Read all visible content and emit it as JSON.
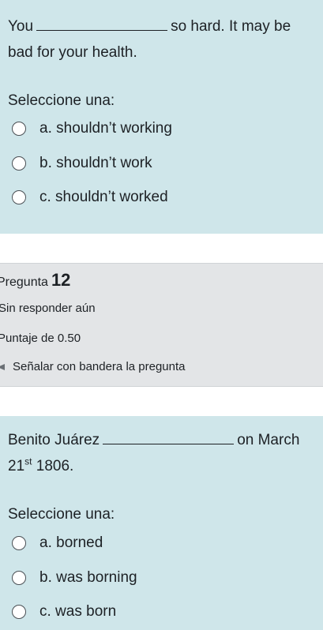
{
  "question1": {
    "text_before_blank": "You",
    "text_after_blank_line1": "so hard. It may be",
    "text_line2": "bad for your health.",
    "prompt": "Seleccione una:",
    "options": [
      {
        "label": "a. shouldn’t working"
      },
      {
        "label": "b. shouldn’t work"
      },
      {
        "label": "c. shouldn’t worked"
      }
    ]
  },
  "question_info": {
    "prefix": "Pregunta",
    "number": "12",
    "state": "Sin responder aún",
    "grade": "Puntaje de 0.50",
    "flag_label": "Señalar con bandera la pregunta"
  },
  "question2": {
    "text_before_blank": "Benito Juárez",
    "text_after_blank": "on March",
    "date_day": "21",
    "date_suffix": "st",
    "date_year": "1806.",
    "prompt": "Seleccione una:",
    "options": [
      {
        "label": "a. borned"
      },
      {
        "label": "b. was borning"
      },
      {
        "label": "c. was born"
      }
    ]
  }
}
